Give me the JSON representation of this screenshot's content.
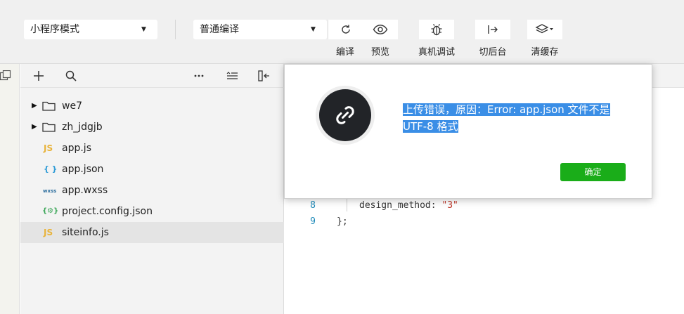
{
  "toolbar": {
    "mode_select": "小程序模式",
    "compile_select": "普通编译",
    "buttons": [
      {
        "label": "编译",
        "icon": "refresh-icon"
      },
      {
        "label": "预览",
        "icon": "eye-icon"
      },
      {
        "label": "真机调试",
        "icon": "bug-icon"
      },
      {
        "label": "切后台",
        "icon": "switch-background-icon"
      },
      {
        "label": "清缓存",
        "icon": "layers-icon"
      }
    ]
  },
  "explorer": {
    "tree": [
      {
        "name": "we7",
        "type": "folder",
        "expandable": true
      },
      {
        "name": "zh_jdgjb",
        "type": "folder",
        "expandable": true
      },
      {
        "name": "app.js",
        "type": "js",
        "badge": "JS",
        "color": "#e8b33a"
      },
      {
        "name": "app.json",
        "type": "json",
        "badge": "{ }",
        "color": "#2b9ad6"
      },
      {
        "name": "app.wxss",
        "type": "wxss",
        "badge": "wxss",
        "color": "#2d6e9e"
      },
      {
        "name": "project.config.json",
        "type": "config",
        "badge": "{⚙}",
        "color": "#3aa657"
      },
      {
        "name": "siteinfo.js",
        "type": "js",
        "badge": "JS",
        "color": "#e8b33a",
        "selected": true
      }
    ]
  },
  "editor": {
    "lines": [
      {
        "number": "8",
        "key": "design_method: ",
        "value": "\"3\""
      },
      {
        "number": "9",
        "key": "};",
        "value": ""
      }
    ]
  },
  "dialog": {
    "message": "上传错误，原因：Error: app.json 文件不是 UTF-8 格式",
    "ok_label": "确定",
    "accent": "#1aad19"
  }
}
